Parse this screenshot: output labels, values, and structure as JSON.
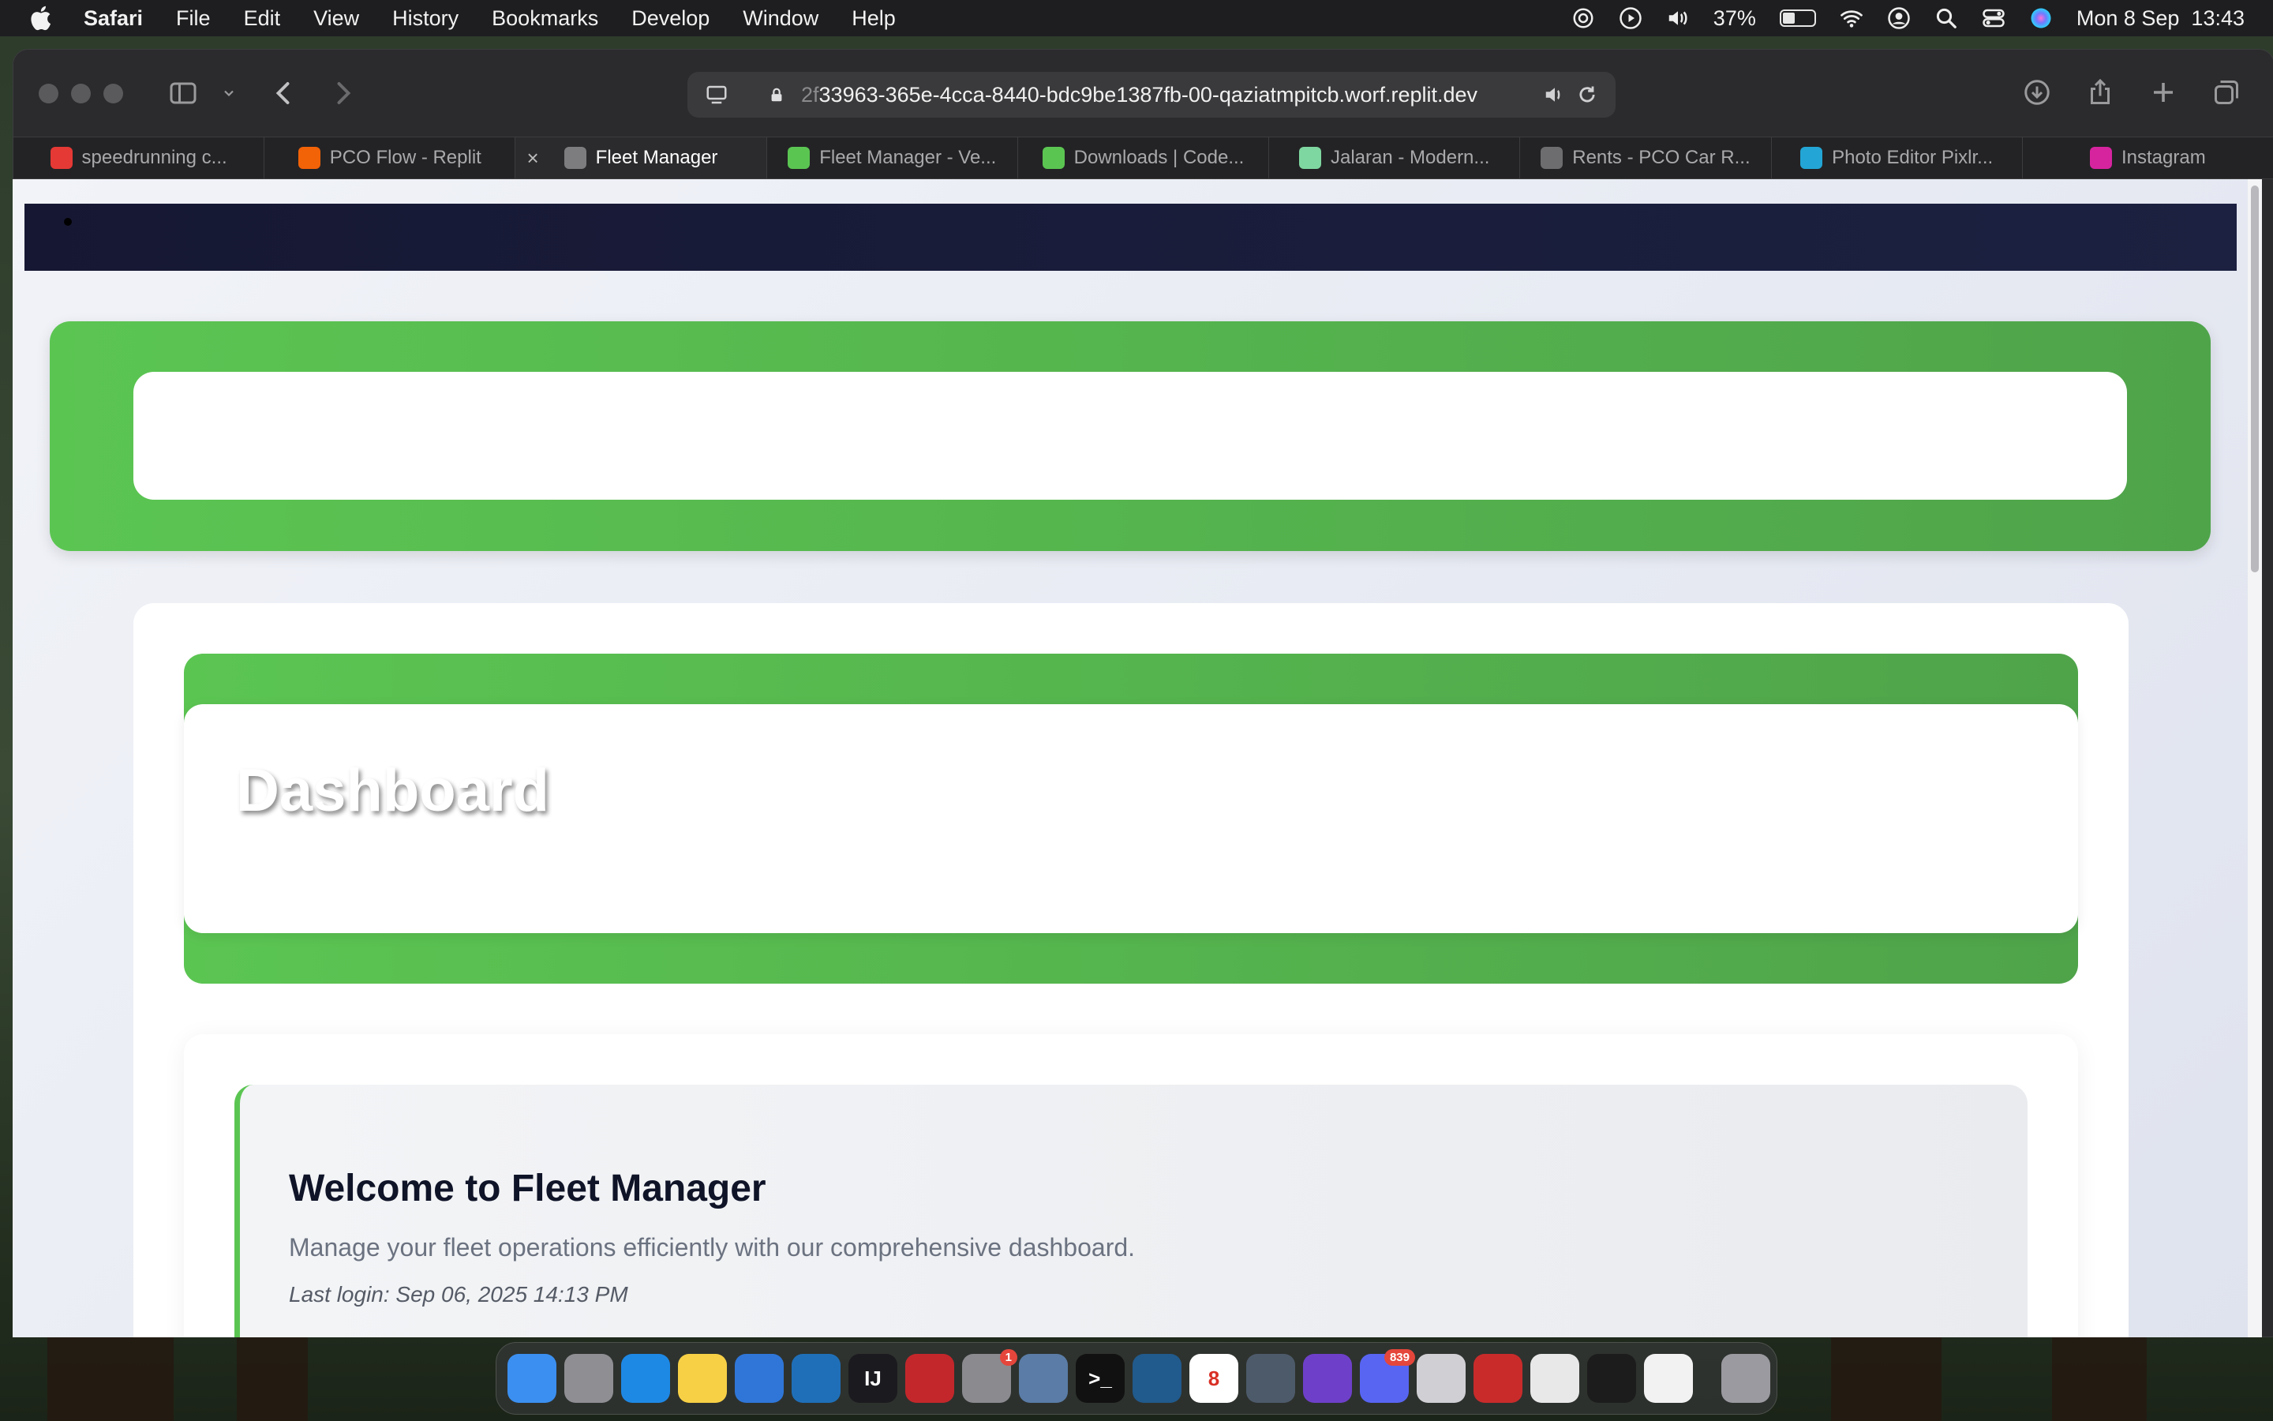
{
  "menubar": {
    "app_name": "Safari",
    "items": [
      "File",
      "Edit",
      "View",
      "History",
      "Bookmarks",
      "Develop",
      "Window",
      "Help"
    ],
    "battery": "37%",
    "battery_level": 0.37,
    "datetime": "Mon 8 Sep  13:43"
  },
  "browser": {
    "url_faded": "2f",
    "url": "33963-365e-4cca-8440-bdc9be1387fb-00-qaziatmpitcb.worf.replit.dev",
    "tabs": [
      {
        "label": "speedrunning c...",
        "icon": "youtube-icon",
        "color": "#e53935",
        "active": false
      },
      {
        "label": "PCO Flow - Replit",
        "icon": "replit-icon",
        "color": "#f26207",
        "active": false
      },
      {
        "label": "Fleet Manager",
        "icon": "r-icon",
        "color": "#7d7d80",
        "active": true
      },
      {
        "label": "Fleet Manager - Ve...",
        "icon": "vercel-icon",
        "color": "#5bc552",
        "active": false
      },
      {
        "label": "Downloads | Code...",
        "icon": "code-icon",
        "color": "#5bc552",
        "active": false
      },
      {
        "label": "Jalaran - Modern...",
        "icon": "flower-icon",
        "color": "#7ed7a0",
        "active": false
      },
      {
        "label": "Rents - PCO Car R...",
        "icon": "g-icon",
        "color": "#6d6d70",
        "active": false
      },
      {
        "label": "Photo Editor Pixlr...",
        "icon": "pixlr-icon",
        "color": "#23a6d5",
        "active": false
      },
      {
        "label": "Instagram",
        "icon": "instagram-icon",
        "color": "#d6249f",
        "active": false
      }
    ]
  },
  "page": {
    "dashboard_title": "Dashboard",
    "welcome": {
      "heading": "Welcome to Fleet Manager",
      "description": "Manage your fleet operations efficiently with our comprehensive dashboard.",
      "last_login": "Last login: Sep 06, 2025 14:13 PM"
    }
  },
  "colors": {
    "accent_green": "#5bc552",
    "nav_dark": "#161833"
  },
  "dock": {
    "items": [
      {
        "name": "finder-icon",
        "color": "#3b8ff0",
        "glyph": ""
      },
      {
        "name": "launchpad-icon",
        "color": "#8e8e93",
        "glyph": ""
      },
      {
        "name": "safari-icon",
        "color": "#1e88e5",
        "glyph": ""
      },
      {
        "name": "notes-icon",
        "color": "#f7d046",
        "glyph": ""
      },
      {
        "name": "migration-icon",
        "color": "#2f76d8",
        "glyph": ""
      },
      {
        "name": "vscode-icon",
        "color": "#1f6fb8",
        "glyph": ""
      },
      {
        "name": "intellij-icon",
        "color": "#1b1b1f",
        "glyph": "IJ"
      },
      {
        "name": "gem-icon",
        "color": "#c3272b",
        "glyph": ""
      },
      {
        "name": "settings-icon",
        "color": "#8a8a8f",
        "glyph": "",
        "badge": "1"
      },
      {
        "name": "preview-icon",
        "color": "#5a7ca6",
        "glyph": ""
      },
      {
        "name": "terminal-icon",
        "color": "#111111",
        "glyph": ">_"
      },
      {
        "name": "mysql-icon",
        "color": "#215a8c",
        "glyph": ""
      },
      {
        "name": "calendar-icon",
        "color": "#ffffff",
        "glyph": "8"
      },
      {
        "name": "quicktime-icon",
        "color": "#4d5a6a",
        "glyph": ""
      },
      {
        "name": "github-icon",
        "color": "#6e40c9",
        "glyph": ""
      },
      {
        "name": "discord-icon",
        "color": "#5865f2",
        "glyph": "",
        "badge": "839"
      },
      {
        "name": "textedit-icon",
        "color": "#d0d0d4",
        "glyph": ""
      },
      {
        "name": "photobooth-icon",
        "color": "#c92b2b",
        "glyph": ""
      },
      {
        "name": "chrome-icon",
        "color": "#e8e8e8",
        "glyph": ""
      },
      {
        "name": "cube-icon",
        "color": "#1c1c1c",
        "glyph": ""
      },
      {
        "name": "chatgpt-icon",
        "color": "#f2f2f2",
        "glyph": ""
      },
      {
        "name": "trash-icon",
        "color": "#9a9aa0",
        "glyph": ""
      }
    ]
  }
}
